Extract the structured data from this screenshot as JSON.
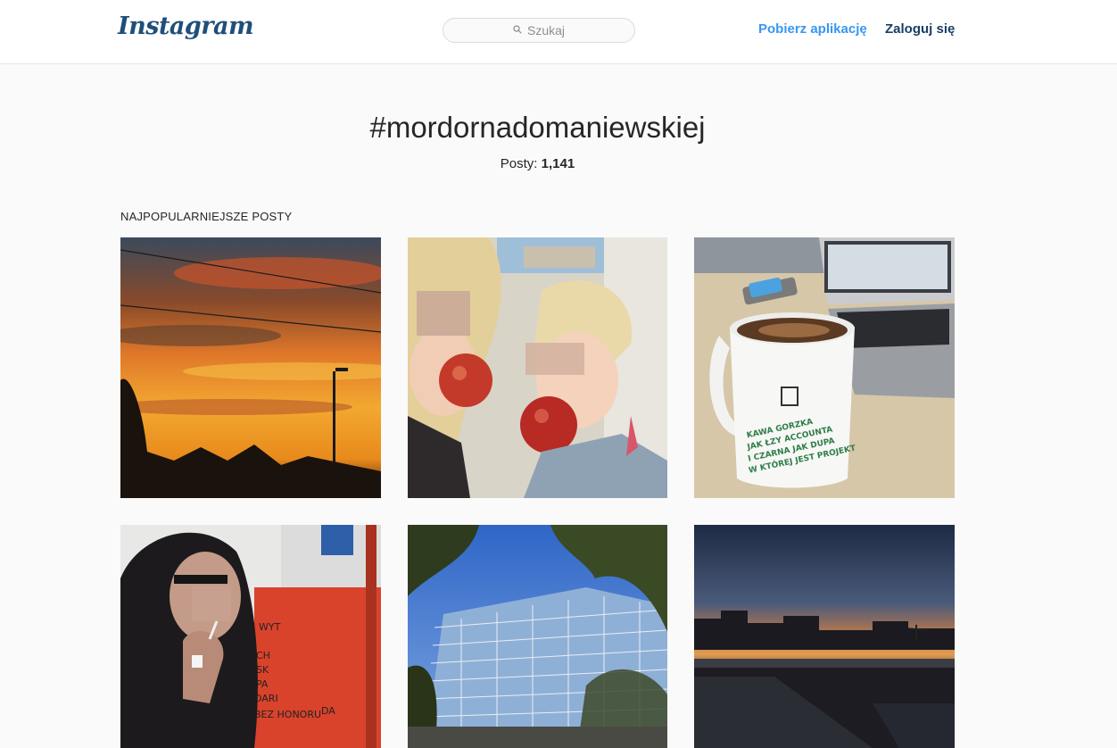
{
  "header": {
    "logo_text": "Instagram",
    "search_placeholder": "Szukaj",
    "get_app_label": "Pobierz aplikację",
    "login_label": "Zaloguj się"
  },
  "tag": {
    "title": "#mordornadomaniewskiej",
    "posts_label": "Posty:",
    "posts_count": "1,141"
  },
  "section": {
    "title": "NAJPOPULARNIEJSZE POSTY"
  },
  "posts": [
    {
      "description": "sunset sky over power lines"
    },
    {
      "description": "two women biting red apples"
    },
    {
      "description": "coffee mug next to laptop",
      "mug_text": [
        "KAWA GORZKA",
        "JAK ŁZY ACCOUNTA",
        "I CZARNA JAK DUPA",
        "W KTÓREJ JEST PROJEKT"
      ]
    },
    {
      "description": "man in hood smoking next to red box",
      "box_text": [
        "WYT",
        "CH",
        "SK",
        "PA",
        "DARI",
        "BEZ HONORU",
        "DA"
      ]
    },
    {
      "description": "glass office building behind trees"
    },
    {
      "description": "city skyline at dusk"
    }
  ],
  "colors": {
    "link_blue": "#3897f0",
    "login_blue": "#1a3f66",
    "logo": "#1f4f7a"
  }
}
